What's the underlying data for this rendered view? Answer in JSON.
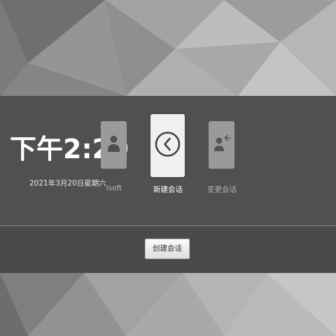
{
  "clock": {
    "time": "下午2:29",
    "date": "2021年3月20日星期六"
  },
  "sessions": [
    {
      "label": "isoft",
      "icon": "user-icon"
    },
    {
      "label": "新建会话",
      "icon": "back-chevron-icon"
    },
    {
      "label": "变更会话",
      "icon": "switch-user-icon"
    }
  ],
  "actions": {
    "create_session": "创建会话"
  }
}
